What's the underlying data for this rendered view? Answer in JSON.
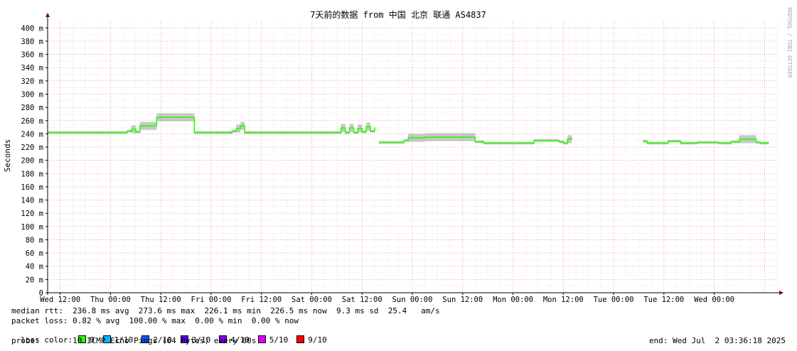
{
  "chart_data": {
    "type": "line",
    "title": "7天前的数据 from 中国 北京 联通 AS4837",
    "ylabel": "Seconds",
    "ylim": [
      0,
      0.41
    ],
    "y_ticks": [
      "0",
      "20 m",
      "40 m",
      "60 m",
      "80 m",
      "100 m",
      "120 m",
      "140 m",
      "160 m",
      "180 m",
      "200 m",
      "220 m",
      "240 m",
      "260 m",
      "280 m",
      "300 m",
      "320 m",
      "340 m",
      "360 m",
      "380 m",
      "400 m"
    ],
    "x_ticks": [
      "Wed 12:00",
      "Thu 00:00",
      "Thu 12:00",
      "Fri 00:00",
      "Fri 12:00",
      "Sat 00:00",
      "Sat 12:00",
      "Sun 00:00",
      "Sun 12:00",
      "Mon 00:00",
      "Mon 12:00",
      "Tue 00:00",
      "Tue 12:00",
      "Wed 00:00"
    ],
    "grid": true,
    "series": [
      {
        "name": "0",
        "x_hours": [
          0,
          18,
          19,
          20,
          21,
          22,
          24,
          25,
          26,
          27,
          28,
          34,
          35,
          42,
          43,
          44,
          45,
          46,
          47,
          50,
          54,
          55,
          56,
          57,
          58,
          59,
          60,
          61,
          62,
          63,
          64,
          65,
          66,
          67,
          68,
          69,
          70,
          71,
          72,
          73,
          74,
          75,
          76,
          77,
          78
        ],
        "values": [
          0.242,
          0.242,
          0.244,
          0.247,
          0.243,
          0.252,
          0.252,
          0.252,
          0.265,
          0.265,
          0.265,
          0.265,
          0.242,
          0.242,
          0.242,
          0.244,
          0.248,
          0.252,
          0.242,
          0.242,
          0.242,
          0.242,
          0.242,
          0.242,
          0.242,
          0.242,
          0.242,
          0.242,
          0.242,
          0.242,
          0.242,
          0.242,
          0.242,
          0.242,
          0.242,
          0.242,
          0.249,
          0.242,
          0.249,
          0.242,
          0.248,
          0.243,
          0.251,
          0.244,
          0.25
        ]
      },
      {
        "name": "0",
        "x_hours": [
          79,
          84,
          85,
          86,
          90,
          100,
          102,
          104,
          105,
          108,
          114,
          116,
          122,
          123,
          124,
          125
        ],
        "values": [
          0.227,
          0.227,
          0.23,
          0.234,
          0.235,
          0.235,
          0.228,
          0.226,
          0.226,
          0.226,
          0.226,
          0.23,
          0.228,
          0.226,
          0.232,
          0.234
        ]
      },
      {
        "name": "0",
        "x_hours": [
          142,
          143,
          144,
          147,
          148,
          150,
          151,
          153,
          154,
          155,
          159,
          160,
          163,
          165,
          166,
          169,
          170,
          172
        ],
        "values": [
          0.229,
          0.226,
          0.226,
          0.226,
          0.229,
          0.229,
          0.226,
          0.226,
          0.226,
          0.227,
          0.227,
          0.226,
          0.228,
          0.232,
          0.232,
          0.227,
          0.226,
          0.226
        ]
      }
    ],
    "loss_color_legend": [
      "0",
      "1/10",
      "2/10",
      "3/10",
      "4/10",
      "5/10",
      "9/10"
    ]
  },
  "legend": {
    "median_rtt": "median rtt:  236.8 ms avg  273.6 ms max  226.1 ms min  226.5 ms now  9.3 ms sd  25.4   am/s",
    "packet_loss": "packet loss: 0.82 % avg  100.00 % max  0.00 % min  0.00 % now",
    "loss_color_label": "loss color:",
    "loss_colors": [
      {
        "label": "0",
        "color": "#26ff00"
      },
      {
        "label": "1/10",
        "color": "#00b8ff"
      },
      {
        "label": "2/10",
        "color": "#0059ff"
      },
      {
        "label": "3/10",
        "color": "#5e00ff"
      },
      {
        "label": "4/10",
        "color": "#7e00ff"
      },
      {
        "label": "5/10",
        "color": "#dd00ff"
      },
      {
        "label": "9/10",
        "color": "#ff0000"
      }
    ],
    "probe": "probe:       10 ICMP Echo Pings (64 Bytes) every 60s",
    "end": "end: Wed Jul  2 03:36:18 2025"
  },
  "watermark": "RRDTOOL / TOBI OETIKER",
  "colors": {
    "line": "#26ff00",
    "smoke": "#9a9a9a",
    "grid_minor": "#e8c8c8",
    "grid_major": "#e07070",
    "axis": "#000000",
    "arrow": "#8b0000"
  }
}
